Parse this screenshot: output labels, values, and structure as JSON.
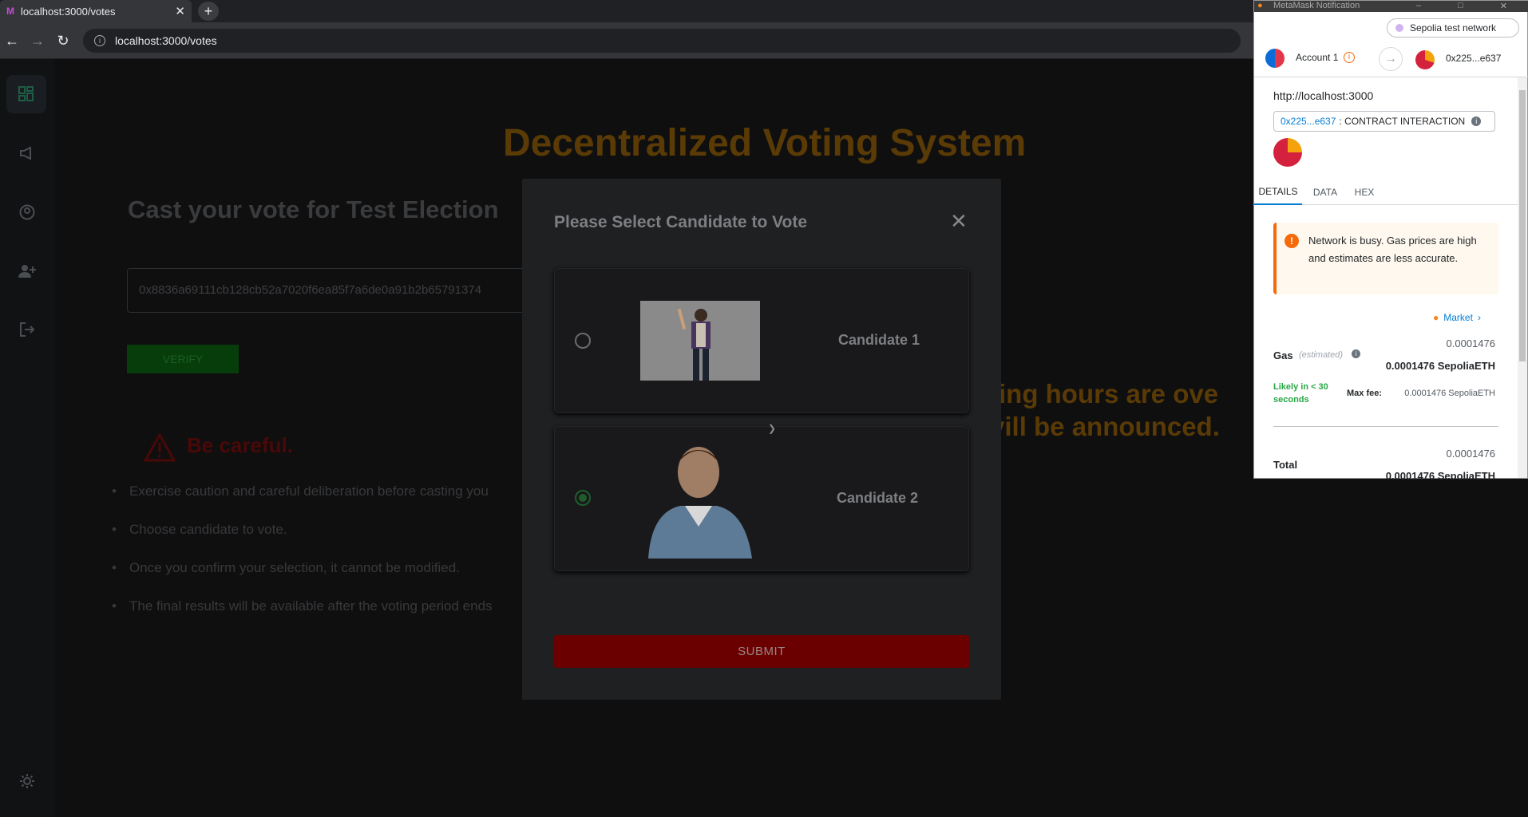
{
  "browser": {
    "tab_title": "localhost:3000/votes",
    "tab_favicon": "M",
    "url": "localhost:3000/votes"
  },
  "sidebar": {
    "items": [
      {
        "icon": "dashboard-icon"
      },
      {
        "icon": "megaphone-icon"
      },
      {
        "icon": "user-icon"
      },
      {
        "icon": "add-user-icon"
      },
      {
        "icon": "logout-icon"
      },
      {
        "icon": "sun-icon"
      }
    ]
  },
  "page": {
    "title": "Decentralized Voting System",
    "subtitle": "Cast your vote for Test Election",
    "hash": "0x8836a69111cb128cb52a7020f6ea85f7a6de0a91b2b65791374",
    "verify_label": "VERIFY",
    "careful": "Be careful.",
    "rules": [
      "Exercise caution and careful deliberation before casting you",
      "Choose candidate to vote.",
      "Once you confirm your selection, it cannot be modified.",
      "The final results will be available after the voting period ends"
    ],
    "over_line1": "ting hours are ove",
    "over_line2": "vill be announced."
  },
  "modal": {
    "title": "Please Select Candidate to Vote",
    "close": "✕",
    "candidates": [
      {
        "name": "Candidate 1",
        "selected": false
      },
      {
        "name": "Candidate 2",
        "selected": true
      }
    ],
    "submit_label": "SUBMIT"
  },
  "metamask": {
    "window_title": "MetaMask Notification",
    "network": "Sepolia test network",
    "account": "Account 1",
    "to_address": "0x225...e637",
    "origin": "http://localhost:3000",
    "contract_address": "0x225...e637",
    "contract_label": ": CONTRACT INTERACTION",
    "tabs": [
      "DETAILS",
      "DATA",
      "HEX"
    ],
    "warning": "Network is busy. Gas prices are high and estimates are less accurate.",
    "market_label": "Market",
    "gas_label": "Gas",
    "gas_estimated": "(estimated)",
    "gas_value": "0.0001476",
    "gas_value_eth": "0.0001476 SepoliaETH",
    "likely": "Likely in < 30 seconds",
    "max_fee_label": "Max fee:",
    "max_fee_value": "0.0001476 SepoliaETH",
    "total_label": "Total",
    "total_value": "0.0001476",
    "total_value_eth": "0.0001476 SepoliaETH",
    "colors": {
      "accent": "#037dd6",
      "warning": "#f66a0a",
      "success": "#28a745"
    }
  }
}
